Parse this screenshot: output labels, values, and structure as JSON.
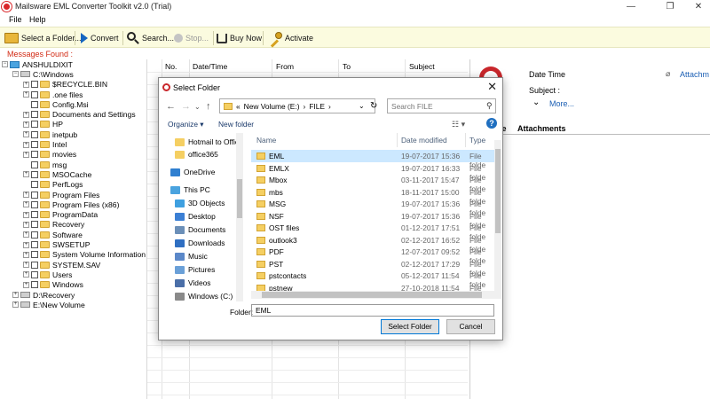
{
  "window": {
    "title": "Mailsware EML Converter Toolkit v2.0 (Trial)",
    "min": "—",
    "max": "❐",
    "close": "✕"
  },
  "menu": [
    "File",
    "Help"
  ],
  "toolbar": {
    "select_folder": "Select a Folder...",
    "convert": "Convert",
    "search": "Search...",
    "stop": "Stop...",
    "buy_now": "Buy Now",
    "activate": "Activate"
  },
  "messages_label": "Messages Found :",
  "tree": {
    "root": "ANSHULDIXIT",
    "drive_c": "C:\\Windows",
    "folders": [
      "$RECYCLE.BIN",
      ".one files",
      "Config.Msi",
      "Documents and Settings",
      "HP",
      "inetpub",
      "Intel",
      "movies",
      "msg",
      "MSOCache",
      "PerfLogs",
      "Program Files",
      "Program Files (x86)",
      "ProgramData",
      "Recovery",
      "Software",
      "SWSETUP",
      "System Volume Information",
      "SYSTEM.SAV",
      "Users",
      "Windows"
    ],
    "drive_d": "D:\\Recovery",
    "drive_e": "E:\\New Volume"
  },
  "grid": {
    "columns": [
      "No.",
      "Date/Time",
      "From",
      "To",
      "Subject"
    ]
  },
  "preview": {
    "date_time": "Date Time",
    "subject": "Subject :",
    "more": "More...",
    "attachments_link": "Attachm",
    "tab_partial": "ge",
    "attachments_tab": "Attachments"
  },
  "dialog": {
    "title": "Select Folder",
    "close": "✕",
    "address": [
      "«",
      "New Volume (E:)",
      "›",
      "FILE",
      "›"
    ],
    "search_placeholder": "Search FILE",
    "organize": "Organize ▾",
    "new_folder": "New folder",
    "nav_items": [
      {
        "label": "Hotmail to Offic",
        "icon": "folder"
      },
      {
        "label": "office365",
        "icon": "folder"
      },
      {
        "label": "OneDrive",
        "icon": "cloud"
      },
      {
        "label": "This PC",
        "icon": "pc"
      },
      {
        "label": "3D Objects",
        "icon": "cube"
      },
      {
        "label": "Desktop",
        "icon": "desktop"
      },
      {
        "label": "Documents",
        "icon": "doc"
      },
      {
        "label": "Downloads",
        "icon": "download"
      },
      {
        "label": "Music",
        "icon": "music"
      },
      {
        "label": "Pictures",
        "icon": "pictures"
      },
      {
        "label": "Videos",
        "icon": "videos"
      },
      {
        "label": "Windows (C:)",
        "icon": "drive"
      }
    ],
    "columns": [
      "Name",
      "Date modified",
      "Type"
    ],
    "files": [
      {
        "name": "EML",
        "date": "19-07-2017 15:36",
        "type": "File folde"
      },
      {
        "name": "EMLX",
        "date": "19-07-2017 16:33",
        "type": "File folde"
      },
      {
        "name": "Mbox",
        "date": "03-11-2017 15:47",
        "type": "File folde"
      },
      {
        "name": "mbs",
        "date": "18-11-2017 15:00",
        "type": "File folde"
      },
      {
        "name": "MSG",
        "date": "19-07-2017 15:36",
        "type": "File folde"
      },
      {
        "name": "NSF",
        "date": "19-07-2017 15:36",
        "type": "File folde"
      },
      {
        "name": "OST files",
        "date": "01-12-2017 17:51",
        "type": "File folde"
      },
      {
        "name": "outlook3",
        "date": "02-12-2017 16:52",
        "type": "File folde"
      },
      {
        "name": "PDF",
        "date": "12-07-2017 09:52",
        "type": "File folde"
      },
      {
        "name": "PST",
        "date": "02-12-2017 17:29",
        "type": "File folde"
      },
      {
        "name": "pstcontacts",
        "date": "05-12-2017 11:54",
        "type": "File folde"
      },
      {
        "name": "pstnew",
        "date": "27-10-2018 11:54",
        "type": "File folde"
      }
    ],
    "folder_label": "Folder:",
    "folder_value": "EML",
    "select_button": "Select Folder",
    "cancel_button": "Cancel"
  },
  "colors": {
    "toolbar_bg": "#fbfbdf",
    "accent_red": "#c9272c",
    "selection": "#cce8ff",
    "link_blue": "#1b5fb4"
  }
}
